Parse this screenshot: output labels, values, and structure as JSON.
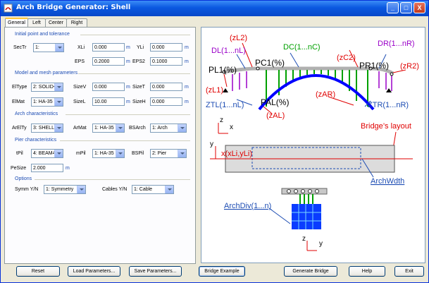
{
  "window": {
    "title": "Arch Bridge Generator: Shell",
    "minimize": "_",
    "maximize": "□",
    "close": "X"
  },
  "tabs": [
    "General",
    "Left",
    "Center",
    "Right"
  ],
  "sections": {
    "initial": "Initial point and tolerance",
    "model": "Model and mesh parameters",
    "arch": "Arch characteristics",
    "pier": "Pier characteristics",
    "options": "Options"
  },
  "fields": {
    "sectr": {
      "label": "SecTr",
      "value": "1:"
    },
    "xli": {
      "label": "XLi",
      "value": "0.000",
      "unit": "m"
    },
    "yli": {
      "label": "YLi",
      "value": "0.000",
      "unit": "m"
    },
    "eps": {
      "label": "EPS",
      "value": "0.2000",
      "unit": "m"
    },
    "eps2": {
      "label": "EPS2",
      "value": "0.1000",
      "unit": "m"
    },
    "eltype": {
      "label": "ElType",
      "value": "2: SOLID<"
    },
    "sizev": {
      "label": "SizeV",
      "value": "0.000",
      "unit": "m"
    },
    "sizet": {
      "label": "SizeT",
      "value": "0.000",
      "unit": "m"
    },
    "elmat": {
      "label": "ElMat",
      "value": "1: HA-35"
    },
    "sizel": {
      "label": "SizeL",
      "value": "10.00",
      "unit": "m"
    },
    "sizeh": {
      "label": "SizeH",
      "value": "0.000",
      "unit": "m"
    },
    "arelty": {
      "label": "ArElTy",
      "value": "3: SHELL"
    },
    "armat": {
      "label": "ArMat",
      "value": "1: HA-35"
    },
    "bsarch": {
      "label": "BSArch",
      "value": "1: Arch"
    },
    "tpil": {
      "label": "tPil",
      "value": "4: BEAM4"
    },
    "mpil": {
      "label": "mPil",
      "value": "1: HA-35"
    },
    "bspil": {
      "label": "BSPil",
      "value": "2: Pier"
    },
    "pesize": {
      "label": "PeSize",
      "value": "2.000",
      "unit": "m"
    },
    "symm": {
      "label": "Symm Y/N",
      "value": "1: Symmetry"
    },
    "cables": {
      "label": "Cables Y/N",
      "value": "1: Cable"
    }
  },
  "diagram": {
    "zl2": "(zL2)",
    "dl": "DL(1...nL)",
    "dc": "DC(1...nC)",
    "zc2": "(zC2)",
    "dr": "DR(1...nR)",
    "pc1": "PC1(%)",
    "pl1": "PL1(%)",
    "pr1": "PR1(%)",
    "zr2": "(zR2)",
    "zl1": "(zL1)",
    "ztl": "ZTL(1...nL)",
    "pal": "PAL(%)",
    "zar": "(zAR)",
    "ztr": "ZTR(1...nR)",
    "zal": "(zAL)",
    "bridge_layout": "Bridge’s layout",
    "xli_yli": "x(xLi,yLi)",
    "archwdth": "ArchWdth",
    "archdiv": "ArchDiv(1...n)",
    "axis_z": "z",
    "axis_x": "x",
    "axis_y": "y"
  },
  "buttons": {
    "reset": "Reset",
    "load": "Load Parameters...",
    "save": "Save Parameters...",
    "example": "Bridge Example",
    "generate": "Generate Bridge",
    "help": "Help",
    "exit": "Exit"
  },
  "colors": {
    "accent_blue": "#1c4cb3",
    "dim_red": "#e00000",
    "arch_blue": "#0000ff",
    "hanger_green": "#00a000",
    "load_purple": "#9a00c8"
  }
}
